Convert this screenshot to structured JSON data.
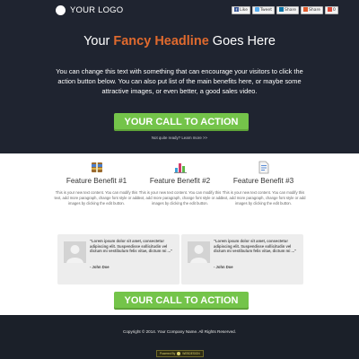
{
  "header": {
    "logo_text": "YOUR LOGO",
    "share_buttons": [
      {
        "label": "Like",
        "icon": "facebook-icon"
      },
      {
        "label": "Tweet",
        "icon": "twitter-icon"
      },
      {
        "label": "Share",
        "icon": "linkedin-icon"
      },
      {
        "label": "Share",
        "icon": "share-icon"
      },
      {
        "label": "0",
        "icon": "google-plus-icon"
      }
    ]
  },
  "hero": {
    "headline_prefix": "Your ",
    "headline_highlight": "Fancy Headline",
    "headline_suffix": " Goes Here",
    "intro_text": "You can change this text with something that can encourage your visitors to click the action button below. You can also put list of the main benefits here, or maybe some attractive images, or even better, a good sales video.",
    "cta_label": "YOUR CALL TO ACTION",
    "subcta_text": "Not quite ready? Learn more >>"
  },
  "features": [
    {
      "title": "Feature Benefit #1",
      "icon": "archive-icon",
      "desc": "This is your new text content. You can modify this text, add more paragraph, change font style or add images by clicking the edit button."
    },
    {
      "title": "Feature Benefit #2",
      "icon": "bar-chart-icon",
      "desc": "This is your new text content. You can modify this text, add more paragraph, change font style or add images by clicking the edit button."
    },
    {
      "title": "Feature Benefit #3",
      "icon": "document-icon",
      "desc": "This is your new text content. You can modify this text, add more paragraph, change font style or add images by clicking the edit button."
    }
  ],
  "testimonials": [
    {
      "quote": "\"Lorem ipsum dolor sit amet, consectetur adipiscing elit. Suspendisse sollicitudin vel dictum mi vestibulum felis vitae, dictum mi ...\"",
      "author": "- John Doe"
    },
    {
      "quote": "\"Lorem ipsum dolor sit amet, consectetur adipiscing elit. Suspendisse sollicitudin vel dictum mi vestibulum felis vitae, dictum mi ...\"",
      "author": "- John Doe"
    }
  ],
  "cta_bottom_label": "YOUR CALL TO ACTION",
  "footer": {
    "copyright": "Copyright © 2014. Your Company Name. All Rights Reserved.",
    "powered_by": "Powered By",
    "powered_brand": "WEBDESIGN"
  },
  "colors": {
    "background": "#1f2430",
    "headline_accent": "#e06a2e",
    "cta_green": "#74c44a"
  }
}
